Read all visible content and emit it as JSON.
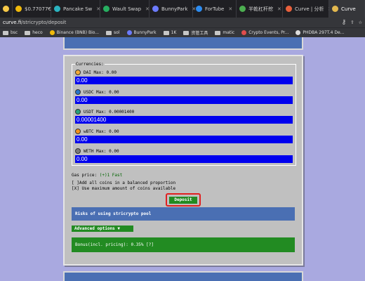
{
  "browser": {
    "tabs": [
      {
        "label": "",
        "color": "#f7c948"
      },
      {
        "label": "$0.77077€",
        "color": "#f0b90b"
      },
      {
        "label": "Pancake Sw",
        "color": "#2bb3c0"
      },
      {
        "label": "Wault Swap",
        "color": "#27ae60"
      },
      {
        "label": "BunnyPark",
        "color": "#6c7bff"
      },
      {
        "label": "ForTube",
        "color": "#2d8cf0"
      },
      {
        "label": "半乾杠杆挖",
        "color": "#4caf50"
      },
      {
        "label": "Curve | 分析",
        "color": "#e8603c"
      },
      {
        "label": "Curve",
        "color": "#e4b94f"
      }
    ],
    "url_host": "curve.fi",
    "url_path": "/stricrypto/deposit",
    "bookmarks": [
      "bsc",
      "heco",
      "Binance (BNB) Bio...",
      "sol",
      "BunnyPark",
      "1K",
      "资管工具",
      "matic",
      "Crypto Events, Pr...",
      "PHDBA 297T.4 De..."
    ]
  },
  "currencies": {
    "legend": "Currencies:",
    "items": [
      {
        "label": "DAI Max: 0.00",
        "value": "0.00",
        "color": "#f5ac37"
      },
      {
        "label": "USDC Max: 0.00",
        "value": "0.00",
        "color": "#2775ca"
      },
      {
        "label": "USDT Max: 0.00001400",
        "value": "0.00001400",
        "color": "#26a17b"
      },
      {
        "label": "wBTC Max: 0.00",
        "value": "0.00",
        "color": "#f7931a"
      },
      {
        "label": "WETH Max: 0.00",
        "value": "0.00",
        "color": "#7b7b7b"
      }
    ]
  },
  "gas": {
    "label": "Gas price:",
    "option": "(+)1 Fast"
  },
  "options": {
    "balanced": "[ ]Add all coins in a balanced proportion",
    "max": "[X] Use maximum amount of coins available"
  },
  "deposit_label": "Deposit",
  "risks_label": "Risks of using stricrypto pool",
  "advanced_label": "Advanced options ▼",
  "bonus_text": "Bonus(incl. pricing): 0.35% [?]"
}
